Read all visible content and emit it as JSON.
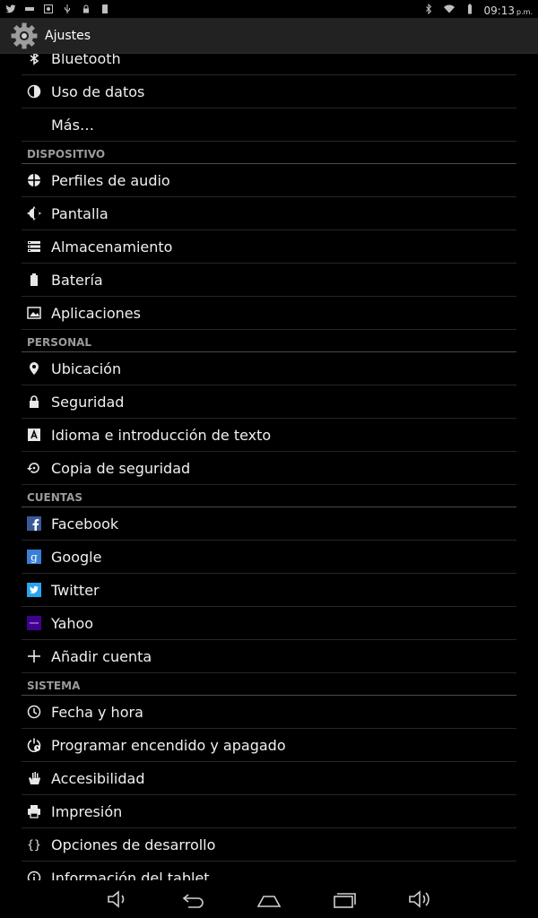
{
  "status_bar": {
    "time": "09:13",
    "ampm": "p.m."
  },
  "action_bar": {
    "title": "Ajustes"
  },
  "rows": [
    {
      "type": "item",
      "key": "bluetooth",
      "label": "Bluetooth",
      "icon": "bluetooth-icon",
      "partial": true
    },
    {
      "type": "item",
      "key": "uso-de-datos",
      "label": "Uso de datos",
      "icon": "data-usage-icon"
    },
    {
      "type": "item",
      "key": "mas",
      "label": "Más…",
      "icon": ""
    },
    {
      "type": "section",
      "key": "dispositivo",
      "label": "DISPOSITIVO"
    },
    {
      "type": "item",
      "key": "perfiles-de-audio",
      "label": "Perfiles de audio",
      "icon": "audio-profiles-icon"
    },
    {
      "type": "item",
      "key": "pantalla",
      "label": "Pantalla",
      "icon": "display-icon"
    },
    {
      "type": "item",
      "key": "almacenamiento",
      "label": "Almacenamiento",
      "icon": "storage-icon"
    },
    {
      "type": "item",
      "key": "bateria",
      "label": "Batería",
      "icon": "battery-icon"
    },
    {
      "type": "item",
      "key": "aplicaciones",
      "label": "Aplicaciones",
      "icon": "apps-icon"
    },
    {
      "type": "section",
      "key": "personal",
      "label": "PERSONAL"
    },
    {
      "type": "item",
      "key": "ubicacion",
      "label": "Ubicación",
      "icon": "location-icon"
    },
    {
      "type": "item",
      "key": "seguridad",
      "label": "Seguridad",
      "icon": "lock-icon"
    },
    {
      "type": "item",
      "key": "idioma",
      "label": "Idioma e introducción de texto",
      "icon": "language-icon"
    },
    {
      "type": "item",
      "key": "copia",
      "label": "Copia de seguridad",
      "icon": "backup-icon"
    },
    {
      "type": "section",
      "key": "cuentas",
      "label": "CUENTAS"
    },
    {
      "type": "item",
      "key": "facebook",
      "label": "Facebook",
      "icon": "facebook-icon"
    },
    {
      "type": "item",
      "key": "google",
      "label": "Google",
      "icon": "google-icon"
    },
    {
      "type": "item",
      "key": "twitter",
      "label": "Twitter",
      "icon": "twitter-icon"
    },
    {
      "type": "item",
      "key": "yahoo",
      "label": "Yahoo",
      "icon": "yahoo-icon"
    },
    {
      "type": "item",
      "key": "anadir-cuenta",
      "label": "Añadir cuenta",
      "icon": "add-icon"
    },
    {
      "type": "section",
      "key": "sistema",
      "label": "SISTEMA"
    },
    {
      "type": "item",
      "key": "fecha-y-hora",
      "label": "Fecha y hora",
      "icon": "clock-icon"
    },
    {
      "type": "item",
      "key": "programar",
      "label": "Programar encendido y apagado",
      "icon": "power-schedule-icon"
    },
    {
      "type": "item",
      "key": "accesibilidad",
      "label": "Accesibilidad",
      "icon": "accessibility-icon"
    },
    {
      "type": "item",
      "key": "impresion",
      "label": "Impresión",
      "icon": "print-icon"
    },
    {
      "type": "item",
      "key": "opciones-desarrollo",
      "label": "Opciones de desarrollo",
      "icon": "developer-icon"
    },
    {
      "type": "item",
      "key": "informacion",
      "label": "Información del tablet",
      "icon": "info-icon"
    }
  ],
  "colors": {
    "accent": "#33b5e5",
    "background": "#000000",
    "action_bar": "#222222",
    "facebook": "#3b5998",
    "google": "#3a7fd5",
    "twitter": "#2aa3ef",
    "yahoo": "#400090"
  }
}
